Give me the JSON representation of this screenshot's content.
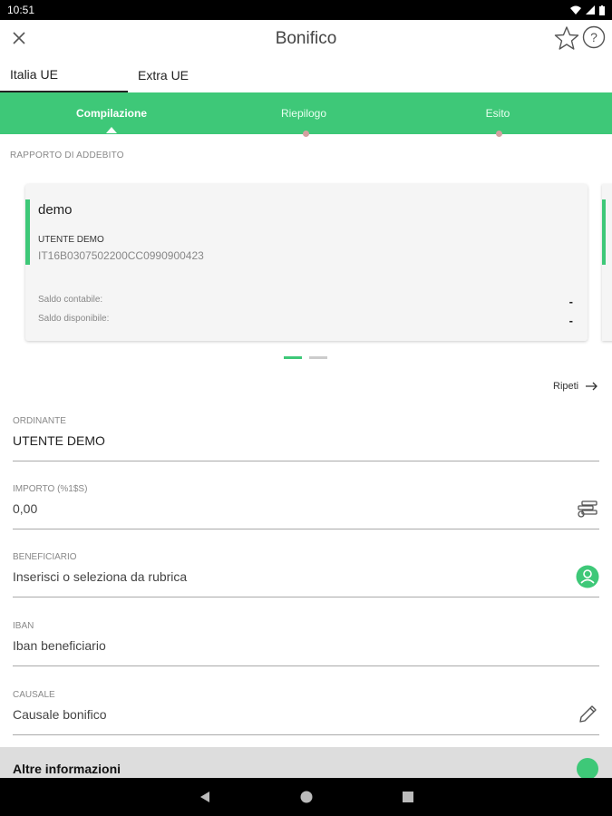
{
  "status_bar": {
    "time": "10:51"
  },
  "app_bar": {
    "title": "Bonifico"
  },
  "tabs": [
    {
      "label": "Italia UE"
    },
    {
      "label": "Extra UE"
    }
  ],
  "stepper": {
    "steps": [
      {
        "label": "Compilazione"
      },
      {
        "label": "Riepilogo"
      },
      {
        "label": "Esito"
      }
    ],
    "active_color": "#3ec878"
  },
  "debit_section": {
    "label": "RAPPORTO DI ADDEBITO",
    "card": {
      "name": "demo",
      "owner": "UTENTE DEMO",
      "iban": "IT16B0307502200CC0990900423",
      "saldo_contabile_label": "Saldo contabile:",
      "saldo_contabile_value": "-",
      "saldo_disponibile_label": "Saldo disponibile:",
      "saldo_disponibile_value": "-"
    }
  },
  "ripeti_label": "Ripeti",
  "form": {
    "ordinante": {
      "label": "ORDINANTE",
      "value": "UTENTE DEMO"
    },
    "importo": {
      "label": "IMPORTO (%1$S)",
      "value": "0,00"
    },
    "beneficiario": {
      "label": "BENEFICIARIO",
      "placeholder": "Inserisci o seleziona da rubrica"
    },
    "iban": {
      "label": "IBAN",
      "placeholder": "Iban beneficiario"
    },
    "causale": {
      "label": "CAUSALE",
      "placeholder": "Causale bonifico"
    }
  },
  "altre_informazioni": {
    "label": "Altre informazioni"
  },
  "colors": {
    "brand_green": "#3ec878",
    "status_bar": "#000000"
  }
}
